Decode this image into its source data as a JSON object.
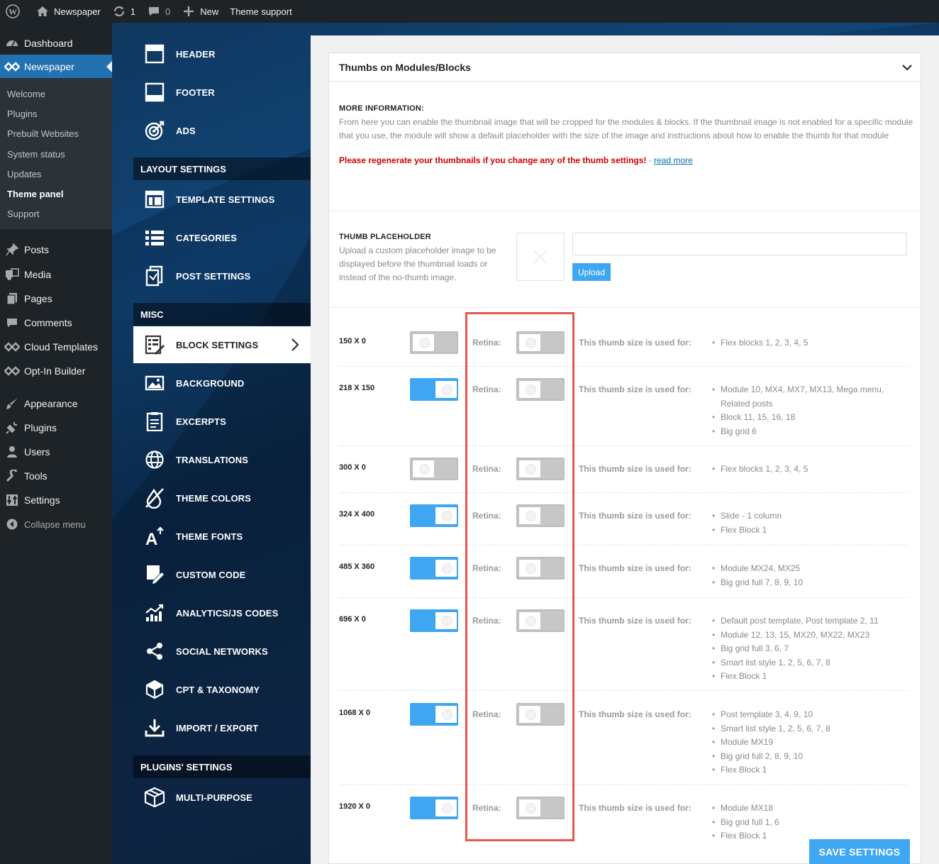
{
  "adminbar": {
    "site_name": "Newspaper",
    "updates_count": "1",
    "comments_count": "0",
    "new_label": "New",
    "theme_support": "Theme support"
  },
  "wp_menu": {
    "dashboard": "Dashboard",
    "newspaper": "Newspaper",
    "sub": [
      "Welcome",
      "Plugins",
      "Prebuilt Websites",
      "System status",
      "Updates",
      "Theme panel",
      "Support"
    ],
    "posts": "Posts",
    "media": "Media",
    "pages": "Pages",
    "comments": "Comments",
    "cloud_templates": "Cloud Templates",
    "optin_builder": "Opt-In Builder",
    "appearance": "Appearance",
    "plugins": "Plugins",
    "users": "Users",
    "tools": "Tools",
    "settings": "Settings",
    "collapse": "Collapse menu"
  },
  "theme_nav": {
    "header": "HEADER",
    "footer": "FOOTER",
    "ads": "ADS",
    "layout_settings": "LAYOUT SETTINGS",
    "template_settings": "TEMPLATE SETTINGS",
    "categories": "CATEGORIES",
    "post_settings": "POST SETTINGS",
    "misc": "MISC",
    "block_settings": "BLOCK SETTINGS",
    "background": "BACKGROUND",
    "excerpts": "EXCERPTS",
    "translations": "TRANSLATIONS",
    "theme_colors": "THEME COLORS",
    "theme_fonts": "THEME FONTS",
    "custom_code": "CUSTOM CODE",
    "analytics": "ANALYTICS/JS CODES",
    "social_networks": "SOCIAL NETWORKS",
    "cpt_taxonomy": "CPT & TAXONOMY",
    "import_export": "IMPORT / EXPORT",
    "plugins_settings": "PLUGINS' SETTINGS",
    "multi_purpose": "MULTI-PURPOSE"
  },
  "panel": {
    "title": "Thumbs on Modules/Blocks",
    "more_info_title": "MORE INFORMATION:",
    "more_info_text": "From here you can enable the thumbnail image that will be cropped for the modules & blocks. If the thumbnail image is not enabled for a specific module that you use, the module will show a default placeholder with the size of the image and instructions about how to enable the thumb for that module",
    "regen_warning": "Please regenerate your thumbnails if you change any of the thumb settings!",
    "regen_sep": " - ",
    "read_more": "read more",
    "placeholder_title": "THUMB PLACEHOLDER",
    "placeholder_desc": "Upload a custom placeholder image to be displayed before the thumbnail loads or instead of the no-thumb image.",
    "placeholder_value": "",
    "upload_label": "Upload",
    "retina_label": "Retina:",
    "used_for_label": "This thumb size is used for:",
    "save_label": "SAVE SETTINGS"
  },
  "thumbs": [
    {
      "size": "150 X 0",
      "enabled": false,
      "retina": false,
      "uses": [
        "Flex blocks 1, 2, 3, 4, 5"
      ]
    },
    {
      "size": "218 X 150",
      "enabled": true,
      "retina": false,
      "uses": [
        "Module 10, MX4, MX7, MX13, Mega menu, Related posts",
        "Block 11, 15, 16, 18",
        "Big grid 6"
      ]
    },
    {
      "size": "300 X 0",
      "enabled": false,
      "retina": false,
      "uses": [
        "Flex blocks 1, 2, 3, 4, 5"
      ]
    },
    {
      "size": "324 X 400",
      "enabled": true,
      "retina": false,
      "uses": [
        "Slide - 1 column",
        "Flex Block 1"
      ]
    },
    {
      "size": "485 X 360",
      "enabled": true,
      "retina": false,
      "uses": [
        "Module MX24, MX25",
        "Big grid full 7, 8, 9, 10"
      ]
    },
    {
      "size": "696 X 0",
      "enabled": true,
      "retina": false,
      "uses": [
        "Default post template, Post template 2, 11",
        "Module 12, 13, 15, MX20, MX22, MX23",
        "Big grid full 3, 6, 7",
        "Smart list style 1, 2, 5, 6, 7, 8",
        "Flex Block 1"
      ]
    },
    {
      "size": "1068 X 0",
      "enabled": true,
      "retina": false,
      "uses": [
        "Post template 3, 4, 9, 10",
        "Smart list style 1, 2, 5, 6, 7, 8",
        "Module MX19",
        "Big grid full 2, 8, 9, 10",
        "Flex Block 1"
      ]
    },
    {
      "size": "1920 X 0",
      "enabled": true,
      "retina": false,
      "uses": [
        "Module MX18",
        "Big grid full 1, 6",
        "Flex Block 1"
      ]
    }
  ],
  "colors": {
    "admin_bar": "#1d2327",
    "wp_active": "#2271b1",
    "toggle_on": "#3fa7f2",
    "toggle_off": "#c7c7c7",
    "warning": "#d00000",
    "highlight_box": "#e5554b"
  }
}
